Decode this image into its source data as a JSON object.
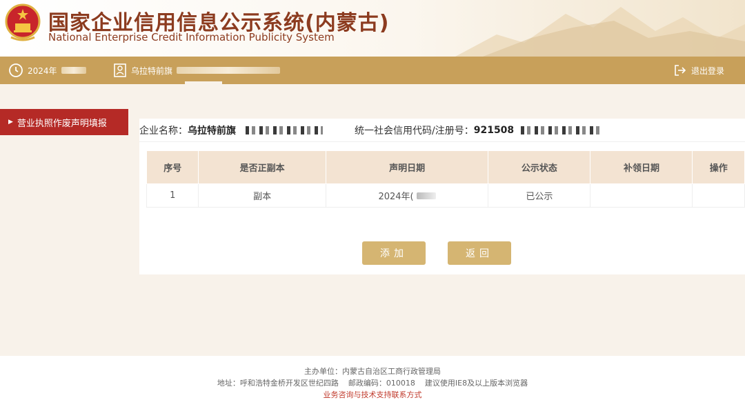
{
  "header": {
    "title_cn": "国家企业信用信息公示系统(内蒙古)",
    "title_en": "National Enterprise Credit Information Publicity System",
    "emblem_icon": "national-emblem-icon"
  },
  "navbar": {
    "date_prefix": "2024年",
    "enterprise_prefix": "乌拉特前旗",
    "logout_label": "退出登录",
    "icons": {
      "date": "clock-icon",
      "enterprise": "user-card-icon",
      "logout": "logout-icon"
    }
  },
  "sidebar": {
    "items": [
      {
        "label": "营业执照作废声明填报",
        "arrow": "▶"
      }
    ]
  },
  "info": {
    "name_label": "企业名称：",
    "name_value": "乌拉特前旗",
    "code_label": "统一社会信用代码/注册号：",
    "code_value": "921508"
  },
  "table": {
    "headers": [
      "序号",
      "是否正副本",
      "声明日期",
      "公示状态",
      "补领日期",
      "操作"
    ],
    "rows": [
      {
        "seq": "1",
        "copy_type": "副本",
        "date": "2024年(",
        "status": "已公示",
        "reissue_date": "",
        "action": ""
      }
    ]
  },
  "buttons": {
    "add_label": "添加",
    "back_label": "返回"
  },
  "footer": {
    "host": "主办单位：内蒙古自治区工商行政管理局",
    "address": "地址：呼和浩特金桥开发区世纪四路    邮政编码：010018    建议使用IE8及以上版本浏览器",
    "support_link": "业务咨询与技术支持联系方式"
  },
  "colors": {
    "brand_brown": "#8c3b1f",
    "nav_gold": "#c8a05a",
    "sidebar_red": "#b52a26",
    "button_gold": "#d5b572",
    "table_header_bg": "#f3e3d2"
  }
}
